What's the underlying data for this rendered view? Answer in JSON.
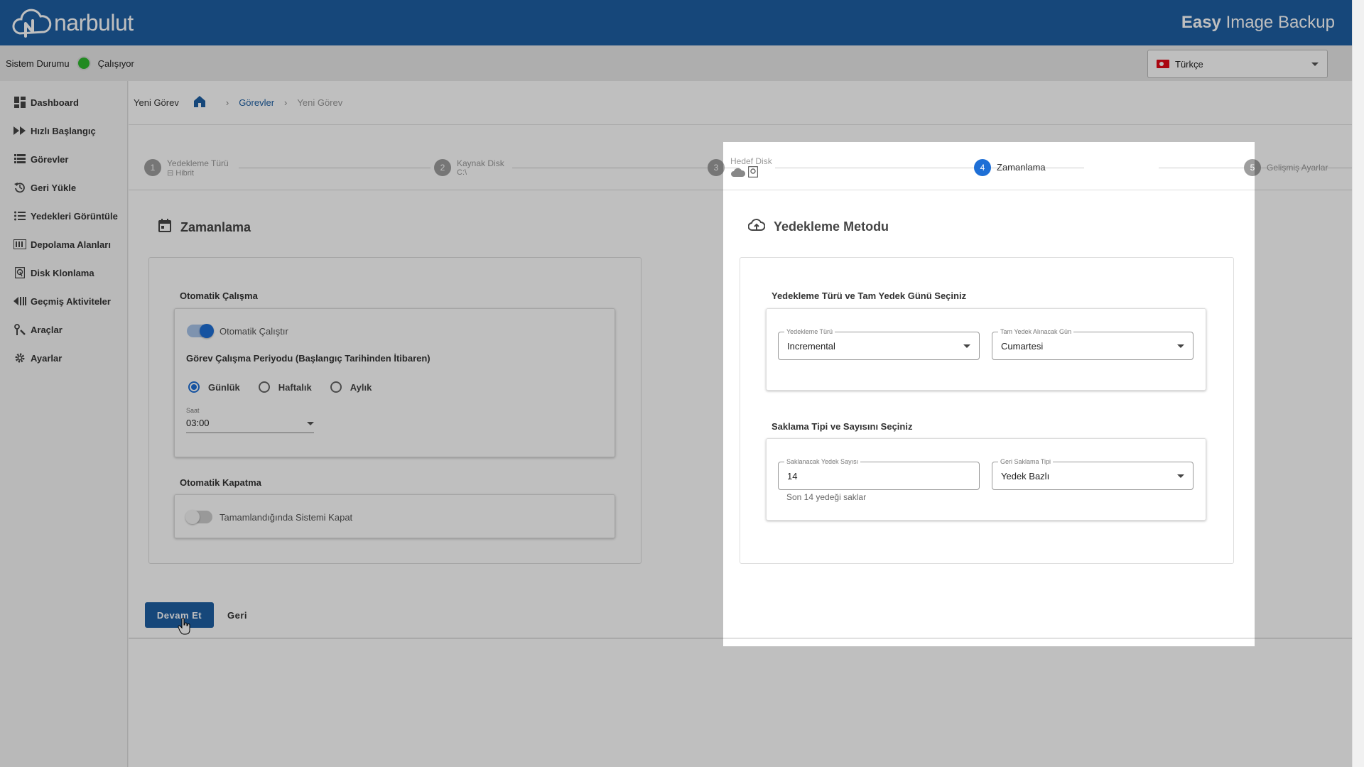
{
  "header": {
    "logo_text": "narbulut",
    "app_title_bold": "Easy",
    "app_title_rest": " Image Backup"
  },
  "status": {
    "label": "Sistem Durumu",
    "value": "Çalışıyor",
    "color": "#2eb82e"
  },
  "language": {
    "selected": "Türkçe"
  },
  "sidebar": {
    "items": [
      {
        "label": "Dashboard",
        "icon": "dashboard-icon"
      },
      {
        "label": "Hızlı Başlangıç",
        "icon": "fast-forward-icon"
      },
      {
        "label": "Görevler",
        "icon": "list-icon"
      },
      {
        "label": "Geri Yükle",
        "icon": "restore-icon"
      },
      {
        "label": "Yedekleri Görüntüle",
        "icon": "bullet-list-icon"
      },
      {
        "label": "Depolama Alanları",
        "icon": "storage-icon"
      },
      {
        "label": "Disk Klonlama",
        "icon": "disk-icon"
      },
      {
        "label": "Geçmiş Aktiviteler",
        "icon": "history-icon"
      },
      {
        "label": "Araçlar",
        "icon": "tools-icon"
      },
      {
        "label": "Ayarlar",
        "icon": "gear-icon"
      }
    ]
  },
  "breadcrumb": {
    "page": "Yeni Görev",
    "link": "Görevler",
    "current": "Yeni Görev"
  },
  "stepper": {
    "steps": [
      {
        "num": "1",
        "title": "Yedekleme Türü",
        "sub": "Hibrit"
      },
      {
        "num": "2",
        "title": "Kaynak Disk",
        "sub": "C:\\"
      },
      {
        "num": "3",
        "title": "Hedef Disk",
        "sub": ""
      },
      {
        "num": "4",
        "title": "Zamanlama",
        "sub": ""
      },
      {
        "num": "5",
        "title": "Gelişmiş Ayarlar",
        "sub": ""
      }
    ],
    "active": 4
  },
  "schedule": {
    "title": "Zamanlama",
    "auto_run_label": "Otomatik Çalışma",
    "auto_run_toggle": "Otomatik Çalıştır",
    "period_label": "Görev Çalışma Periyodu (Başlangıç Tarihinden İtibaren)",
    "options": [
      "Günlük",
      "Haftalık",
      "Aylık"
    ],
    "selected_option": "Günlük",
    "time_label": "Saat",
    "time_value": "03:00",
    "auto_shutdown_label": "Otomatik Kapatma",
    "auto_shutdown_toggle": "Tamamlandığında Sistemi Kapat"
  },
  "method": {
    "title": "Yedekleme Metodu",
    "type_group_label": "Yedekleme Türü ve Tam Yedek Günü Seçiniz",
    "type_label": "Yedekleme Türü",
    "type_value": "Incremental",
    "fullday_label": "Tam Yedek Alınacak Gün",
    "fullday_value": "Cumartesi",
    "retention_group_label": "Saklama Tipi ve Sayısını Seçiniz",
    "count_label": "Saklanacak Yedek Sayısı",
    "count_value": "14",
    "count_hint": "Son 14 yedeği saklar",
    "retention_type_label": "Geri Saklama Tipi",
    "retention_type_value": "Yedek Bazlı"
  },
  "actions": {
    "continue": "Devam Et",
    "back": "Geri"
  }
}
